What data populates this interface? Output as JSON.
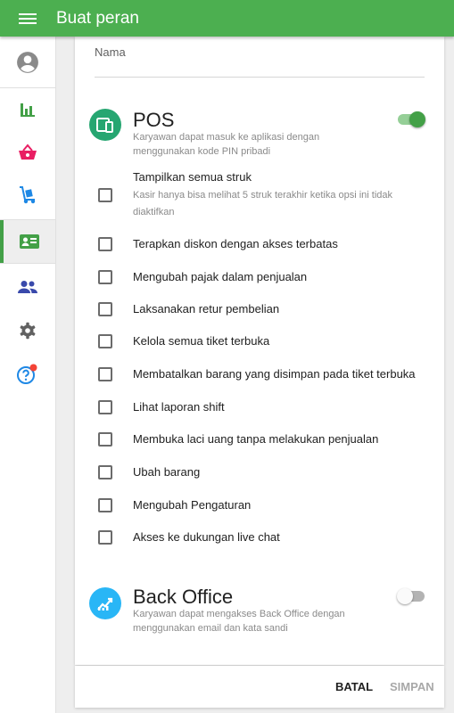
{
  "app": {
    "title": "Buat peran"
  },
  "sidebar": {
    "items": [
      {
        "name": "account",
        "icon": "account-circle-icon"
      },
      {
        "name": "reports",
        "icon": "bar-chart-icon"
      },
      {
        "name": "items",
        "icon": "shopping-basket-icon"
      },
      {
        "name": "inventory",
        "icon": "hand-truck-icon"
      },
      {
        "name": "employees",
        "icon": "id-card-icon",
        "active": true
      },
      {
        "name": "customers",
        "icon": "people-icon"
      },
      {
        "name": "settings",
        "icon": "gear-icon"
      },
      {
        "name": "help",
        "icon": "help-circle-icon",
        "notification": true
      }
    ]
  },
  "form": {
    "name_label": "Nama",
    "name_value": ""
  },
  "pos": {
    "title": "POS",
    "description": "Karyawan dapat masuk ke aplikasi dengan menggunakan kode PIN pribadi",
    "enabled": true,
    "permissions": [
      {
        "label": "Tampilkan semua struk",
        "description": "Kasir hanya bisa melihat 5 struk terakhir ketika opsi ini tidak diaktifkan",
        "checked": false
      },
      {
        "label": "Terapkan diskon dengan akses terbatas",
        "checked": false
      },
      {
        "label": "Mengubah pajak dalam penjualan",
        "checked": false
      },
      {
        "label": "Laksanakan retur pembelian",
        "checked": false
      },
      {
        "label": "Kelola semua tiket terbuka",
        "checked": false
      },
      {
        "label": "Membatalkan barang yang disimpan pada tiket terbuka",
        "checked": false
      },
      {
        "label": "Lihat laporan shift",
        "checked": false
      },
      {
        "label": "Membuka laci uang tanpa melakukan penjualan",
        "checked": false
      },
      {
        "label": "Ubah barang",
        "checked": false
      },
      {
        "label": "Mengubah Pengaturan",
        "checked": false
      },
      {
        "label": "Akses ke dukungan live chat",
        "checked": false
      }
    ]
  },
  "back_office": {
    "title": "Back Office",
    "description": "Karyawan dapat mengakses Back Office dengan menggunakan email dan kata sandi",
    "enabled": false
  },
  "footer": {
    "cancel_label": "BATAL",
    "save_label": "SIMPAN"
  },
  "colors": {
    "accent": "#4caf50",
    "active_icon": "#43a047",
    "pos_icon_bg": "#26a671",
    "back_office_icon_bg": "#29b6f6",
    "notification": "#f44336"
  }
}
